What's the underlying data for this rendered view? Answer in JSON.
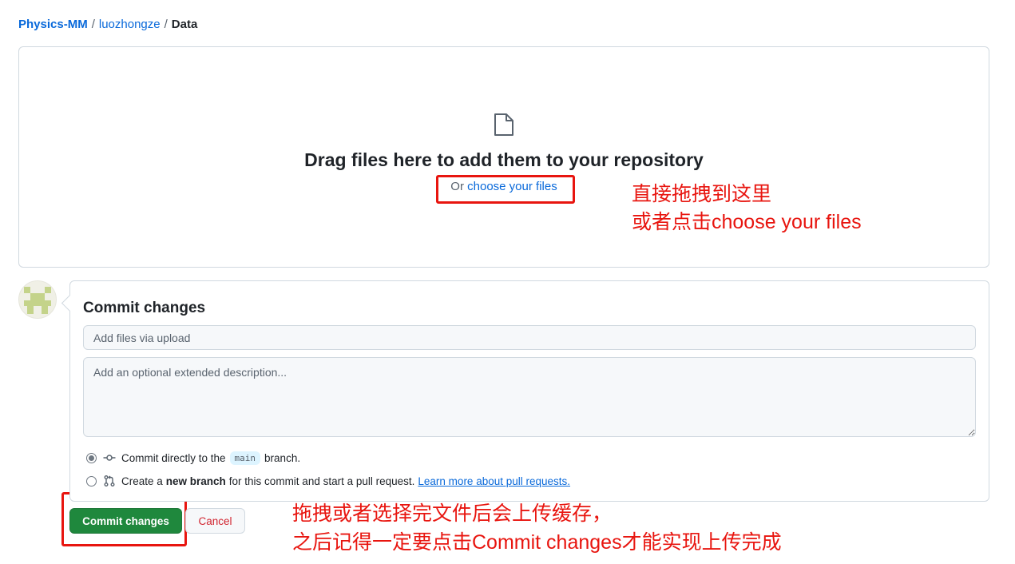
{
  "breadcrumb": {
    "owner": "Physics-MM",
    "repo": "luozhongze",
    "separator": "/",
    "current": "Data"
  },
  "dropzone": {
    "icon": "file-icon",
    "title": "Drag files here to add them to your repository",
    "or_text": "Or",
    "choose_link": "choose your files"
  },
  "commit": {
    "title": "Commit changes",
    "summary_placeholder": "Add files via upload",
    "summary_value": "",
    "description_placeholder": "Add an optional extended description...",
    "description_value": "",
    "option_direct": {
      "prefix": "Commit directly to the",
      "branch": "main",
      "suffix": "branch.",
      "selected": true,
      "icon": "git-commit-icon"
    },
    "option_new_branch": {
      "prefix": "Create a",
      "bold": "new branch",
      "suffix": "for this commit and start a pull request.",
      "link": "Learn more about pull requests.",
      "selected": false,
      "icon": "git-pull-request-icon"
    },
    "commit_button": "Commit changes",
    "cancel_button": "Cancel"
  },
  "annotations": {
    "dropzone_line1": "直接拖拽到这里",
    "dropzone_line2": "或者点击choose your files",
    "commit_line1": "拖拽或者选择完文件后会上传缓存，",
    "commit_line2": "之后记得一定要点击Commit changes才能实现上传完成"
  },
  "colors": {
    "link": "#0969da",
    "primary_button": "#1f883d",
    "cancel_text": "#d1242f",
    "annotation_red": "#e8150f"
  }
}
